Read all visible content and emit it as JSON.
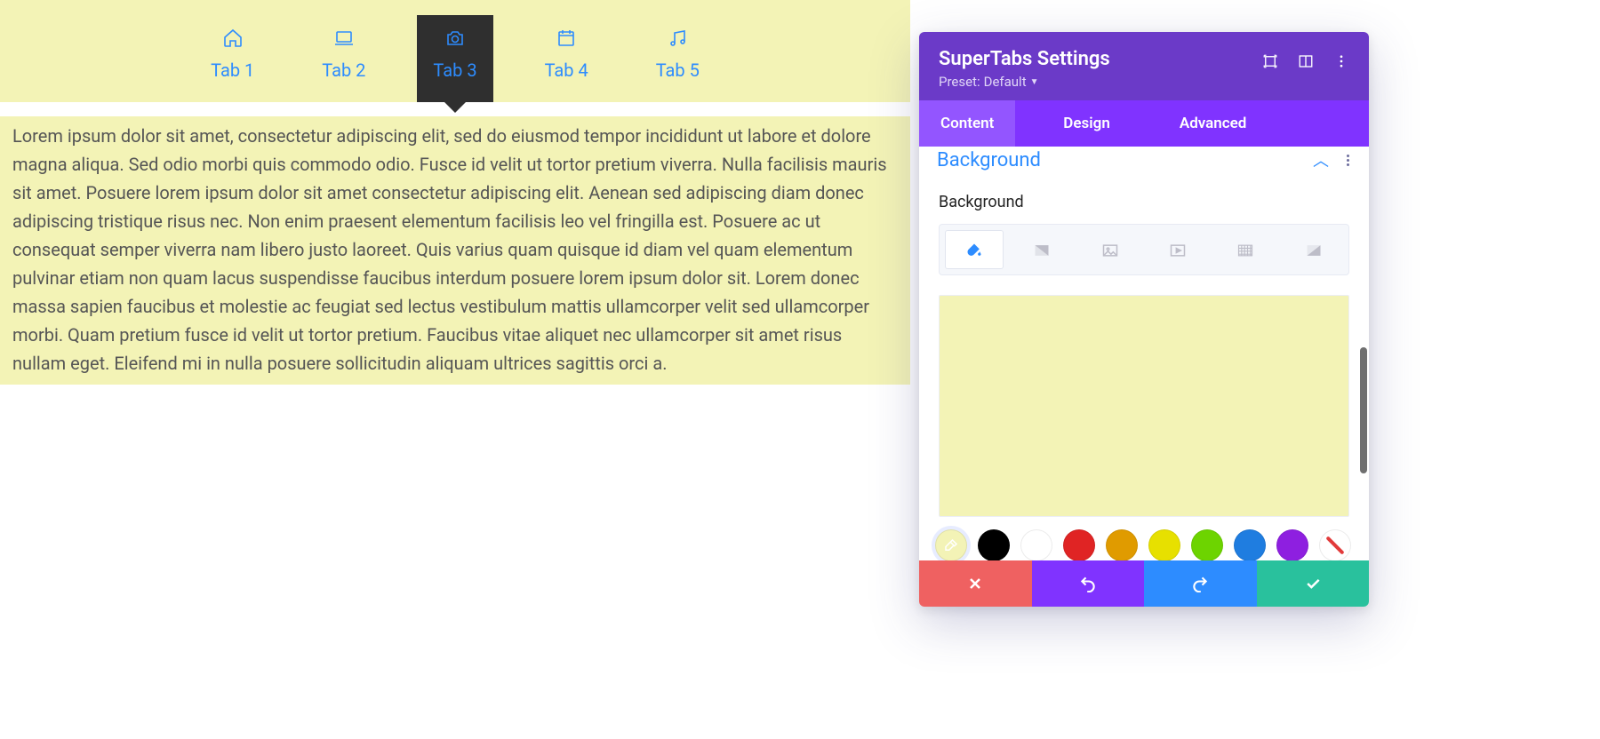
{
  "preview": {
    "tabs": [
      {
        "id": "tab1",
        "label": "Tab 1",
        "icon": "home-icon",
        "active": false
      },
      {
        "id": "tab2",
        "label": "Tab 2",
        "icon": "laptop-icon",
        "active": false
      },
      {
        "id": "tab3",
        "label": "Tab 3",
        "icon": "camera-icon",
        "active": true
      },
      {
        "id": "tab4",
        "label": "Tab 4",
        "icon": "calendar-icon",
        "active": false
      },
      {
        "id": "tab5",
        "label": "Tab 5",
        "icon": "music-icon",
        "active": false
      }
    ],
    "tab_bg": "#f3f3b6",
    "content_text": "Lorem ipsum dolor sit amet, consectetur adipiscing elit, sed do eiusmod tempor incididunt ut labore et dolore magna aliqua. Sed odio morbi quis commodo odio. Fusce id velit ut tortor pretium viverra. Nulla facilisis mauris sit amet. Posuere lorem ipsum dolor sit amet consectetur adipiscing elit. Aenean sed adipiscing diam donec adipiscing tristique risus nec. Non enim praesent elementum facilisis leo vel fringilla est. Posuere ac ut consequat semper viverra nam libero justo laoreet. Quis varius quam quisque id diam vel quam elementum pulvinar etiam non quam lacus suspendisse faucibus interdum posuere lorem ipsum dolor sit. Lorem donec massa sapien faucibus et molestie ac feugiat sed lectus vestibulum mattis ullamcorper velit sed ullamcorper morbi. Quam pretium fusce id velit ut tortor pretium. Faucibus vitae aliquet nec ullamcorper sit amet risus nullam eget. Eleifend mi in nulla posuere sollicitudin aliquam ultrices sagittis orci a."
  },
  "panel": {
    "title": "SuperTabs Settings",
    "preset_label": "Preset:",
    "preset_value": "Default",
    "header_actions": {
      "responsive": "responsive-icon",
      "preview": "preview-icon",
      "menu": "kebab-icon"
    },
    "tabs": [
      {
        "id": "content",
        "label": "Content",
        "active": true
      },
      {
        "id": "design",
        "label": "Design",
        "active": false
      },
      {
        "id": "advanced",
        "label": "Advanced",
        "active": false
      }
    ],
    "section": {
      "title": "Background",
      "expanded": true,
      "field_label": "Background",
      "bg_types": [
        {
          "name": "color",
          "icon": "fill-icon",
          "active": true
        },
        {
          "name": "gradient",
          "icon": "gradient-icon",
          "active": false
        },
        {
          "name": "image",
          "icon": "image-icon",
          "active": false
        },
        {
          "name": "video",
          "icon": "video-icon",
          "active": false
        },
        {
          "name": "pattern",
          "icon": "pattern-icon",
          "active": false
        },
        {
          "name": "mask",
          "icon": "mask-icon",
          "active": false
        }
      ],
      "current_color": "#f3f3b6",
      "swatches": [
        {
          "type": "picker",
          "color": "#f3f3b6"
        },
        {
          "type": "color",
          "color": "#000000"
        },
        {
          "type": "color",
          "color": "#ffffff"
        },
        {
          "type": "color",
          "color": "#e02424"
        },
        {
          "type": "color",
          "color": "#e09b00"
        },
        {
          "type": "color",
          "color": "#e7e000"
        },
        {
          "type": "color",
          "color": "#6dd400"
        },
        {
          "type": "color",
          "color": "#1f7de0"
        },
        {
          "type": "color",
          "color": "#8e1fe0"
        },
        {
          "type": "none",
          "color": "transparent"
        }
      ]
    },
    "footer": {
      "cancel": "cancel",
      "undo": "undo",
      "redo": "redo",
      "save": "save"
    }
  }
}
